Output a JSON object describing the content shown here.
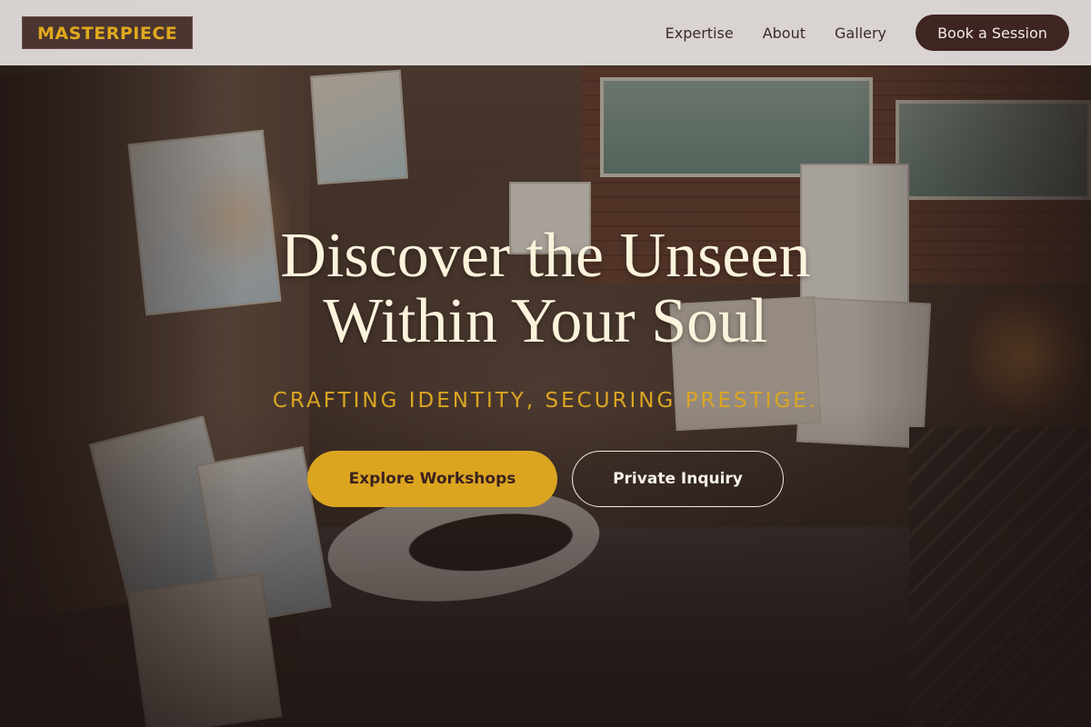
{
  "header": {
    "logo": "MASTERPIECE",
    "nav": [
      "Expertise",
      "About",
      "Gallery"
    ],
    "cta": "Book a Session"
  },
  "hero": {
    "background_image": "art studio interior with canvases and chandeliers",
    "title_line1": "Discover the Unseen",
    "title_line2": "Within Your Soul",
    "subtitle": "CRAFTING IDENTITY, SECURING PRESTIGE.",
    "primary_cta": "Explore Workshops",
    "secondary_cta": "Private Inquiry"
  },
  "colors": {
    "accent_gold": "#dca520",
    "logo_bg": "#4a3530",
    "header_bg": "#e6e2df",
    "button_dark": "#3e2522",
    "title_cream": "#fbf3dc"
  }
}
